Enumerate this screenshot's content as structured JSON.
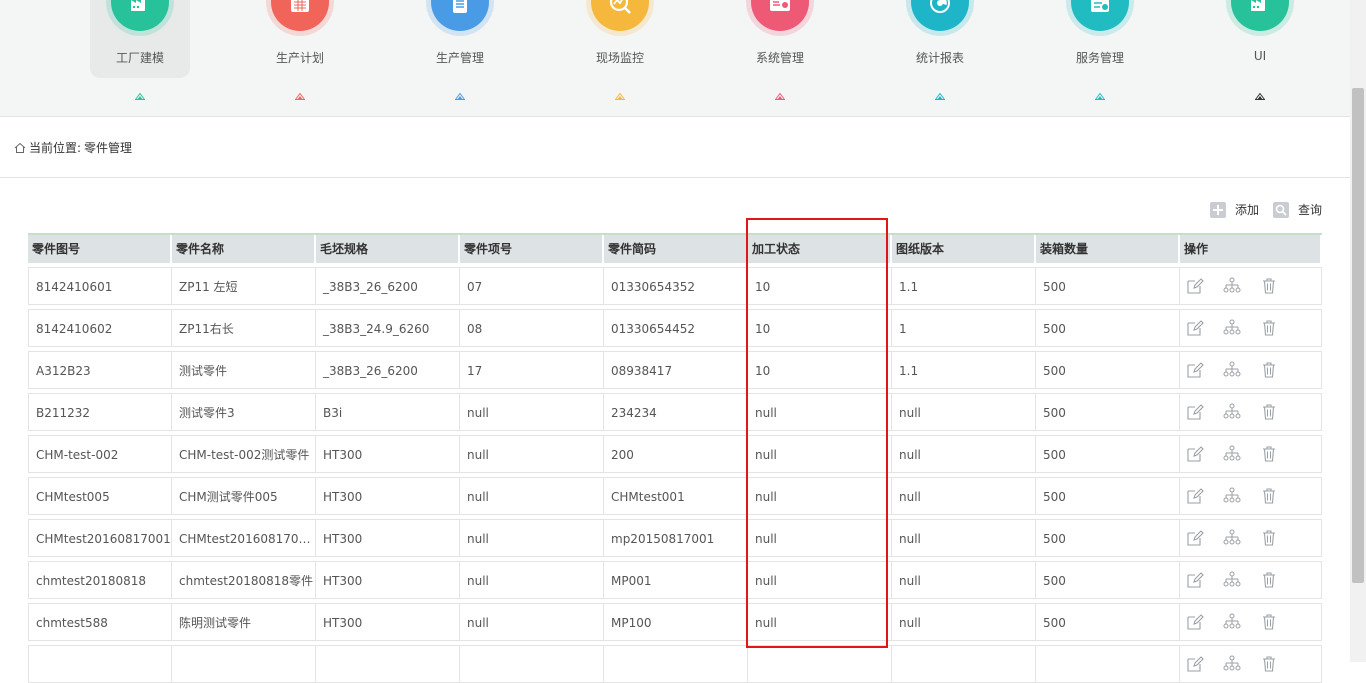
{
  "nav": [
    {
      "label": "工厂建模",
      "color": "#27c29a",
      "icon": "factory-icon",
      "active": true
    },
    {
      "label": "生产计划",
      "color": "#f0645a",
      "icon": "calendar-icon",
      "active": false
    },
    {
      "label": "生产管理",
      "color": "#4a9be6",
      "icon": "clipboard-icon",
      "active": false
    },
    {
      "label": "现场监控",
      "color": "#f5b83d",
      "icon": "monitor-chart-icon",
      "active": false
    },
    {
      "label": "系统管理",
      "color": "#ee5a76",
      "icon": "system-settings-icon",
      "active": false
    },
    {
      "label": "统计报表",
      "color": "#1fb5c9",
      "icon": "report-icon",
      "active": false
    },
    {
      "label": "服务管理",
      "color": "#21bcc2",
      "icon": "service-icon",
      "active": false
    },
    {
      "label": "UI",
      "color": "#27c29a",
      "icon": "factory-icon",
      "active": false
    }
  ],
  "breadcrumb": {
    "prefix": "当前位置:",
    "current": "零件管理"
  },
  "toolbar": {
    "add_label": "添加",
    "query_label": "查询"
  },
  "table": {
    "headers": [
      "零件图号",
      "零件名称",
      "毛坯规格",
      "零件项号",
      "零件简码",
      "加工状态",
      "图纸版本",
      "装箱数量",
      "操作"
    ],
    "rows": [
      [
        "8142410601",
        "ZP11 左短",
        "_38B3_26_6200",
        "07",
        "01330654352",
        "10",
        "1.1",
        "500"
      ],
      [
        "8142410602",
        "ZP11右长",
        "_38B3_24.9_6260",
        "08",
        "01330654452",
        "10",
        "1",
        "500"
      ],
      [
        "A312B23",
        "测试零件",
        "_38B3_26_6200",
        "17",
        "08938417",
        "10",
        "1.1",
        "500"
      ],
      [
        "B211232",
        "测试零件3",
        "B3i",
        "null",
        "234234",
        "null",
        "null",
        "500"
      ],
      [
        "CHM-test-002",
        "CHM-test-002测试零件",
        "HT300",
        "null",
        "200",
        "null",
        "null",
        "500"
      ],
      [
        "CHMtest005",
        "CHM测试零件005",
        "HT300",
        "null",
        "CHMtest001",
        "null",
        "null",
        "500"
      ],
      [
        "CHMtest20160817001",
        "CHMtest2016081700...",
        "HT300",
        "null",
        "mp20150817001",
        "null",
        "null",
        "500"
      ],
      [
        "chmtest20180818",
        "chmtest20180818零件",
        "HT300",
        "null",
        "MP001",
        "null",
        "null",
        "500"
      ],
      [
        "chmtest588",
        "陈明测试零件",
        "HT300",
        "null",
        "MP100",
        "null",
        "null",
        "500"
      ],
      [
        "",
        "",
        "",
        "",
        "",
        "",
        "",
        ""
      ]
    ]
  },
  "accent": {
    "highlight": "#e0161a",
    "header_bg": "#dde2e5"
  }
}
